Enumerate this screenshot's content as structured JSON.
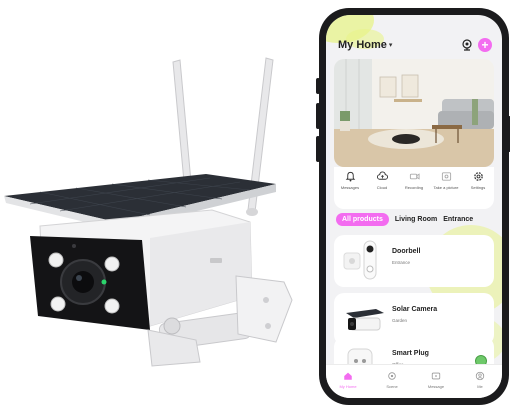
{
  "app": {
    "home_title": "My Home",
    "home_caret": "▾",
    "add_symbol": "+"
  },
  "quick_actions": [
    {
      "label": "Messages",
      "icon": "bell-icon"
    },
    {
      "label": "Cloud",
      "icon": "cloud-icon"
    },
    {
      "label": "Recording",
      "icon": "video-icon"
    },
    {
      "label": "Take a picture",
      "icon": "photo-icon"
    },
    {
      "label": "Settings",
      "icon": "gear-icon"
    }
  ],
  "tabs": [
    {
      "label": "All products",
      "active": true
    },
    {
      "label": "Living Room",
      "active": false
    },
    {
      "label": "Entrance",
      "active": false
    }
  ],
  "devices": [
    {
      "name": "Doorbell",
      "room": "Entrance"
    },
    {
      "name": "Solar Camera",
      "room": "Garden"
    },
    {
      "name": "Smart Plug",
      "room": "Office"
    }
  ],
  "bottom_nav": [
    {
      "label": "My Home",
      "icon": "home-icon",
      "active": true
    },
    {
      "label": "Scene",
      "icon": "scene-icon",
      "active": false
    },
    {
      "label": "Message",
      "icon": "message-icon",
      "active": false
    },
    {
      "label": "Me",
      "icon": "user-icon",
      "active": false
    }
  ],
  "colors": {
    "accent": "#f36cf0",
    "highlight": "#e7f38a",
    "toggle_on": "#6ec96a",
    "phone_body": "#1b1b1d"
  }
}
